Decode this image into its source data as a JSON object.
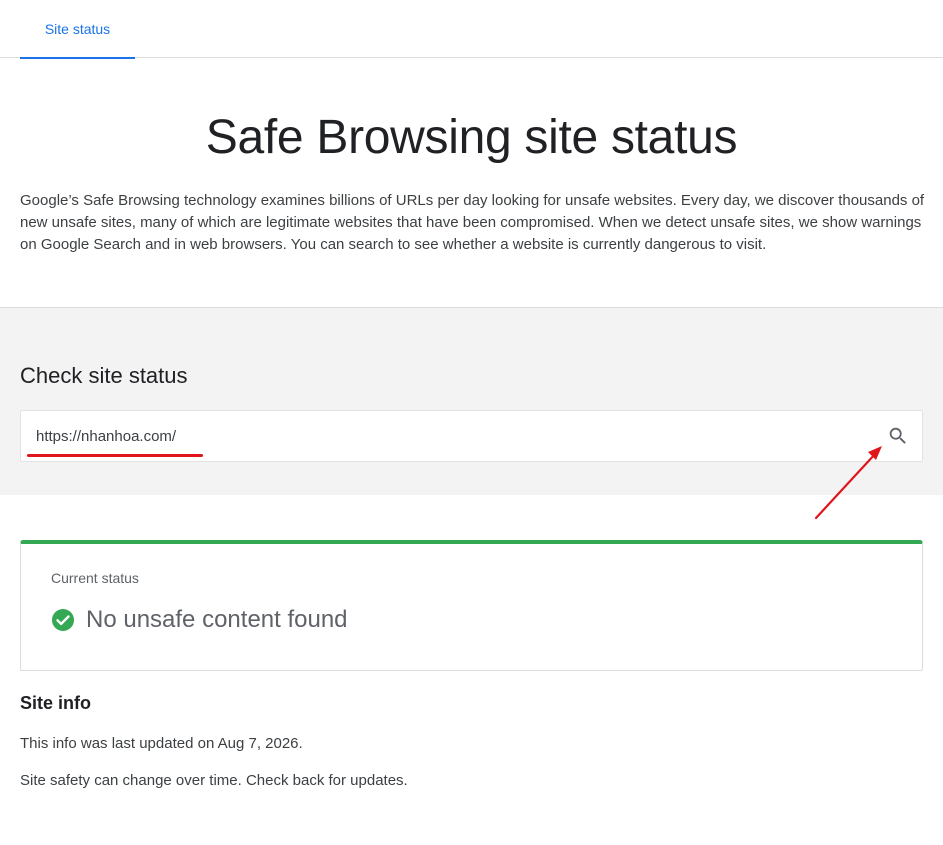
{
  "tabs": [
    {
      "label": "Site status",
      "active": true
    }
  ],
  "page": {
    "title": "Safe Browsing site status",
    "intro": "Google’s Safe Browsing technology examines billions of URLs per day looking for unsafe websites. Every day, we discover thousands of new unsafe sites, many of which are legitimate websites that have been compromised. When we detect unsafe sites, we show warnings on Google Search and in web browsers. You can search to see whether a website is currently dangerous to visit."
  },
  "check": {
    "title": "Check site status",
    "url_value": "https://nhanhoa.com/",
    "search_icon": "search-icon"
  },
  "status": {
    "label": "Current status",
    "result": "No unsafe content found",
    "icon": "check-circle-icon",
    "color": "#34a853"
  },
  "site_info": {
    "title": "Site info",
    "updated": "This info was last updated on Aug 7, 2026.",
    "note": "Site safety can change over time. Check back for updates."
  },
  "colors": {
    "accent": "#1a73e8",
    "success": "#34a853",
    "annotation": "#e0151b"
  }
}
